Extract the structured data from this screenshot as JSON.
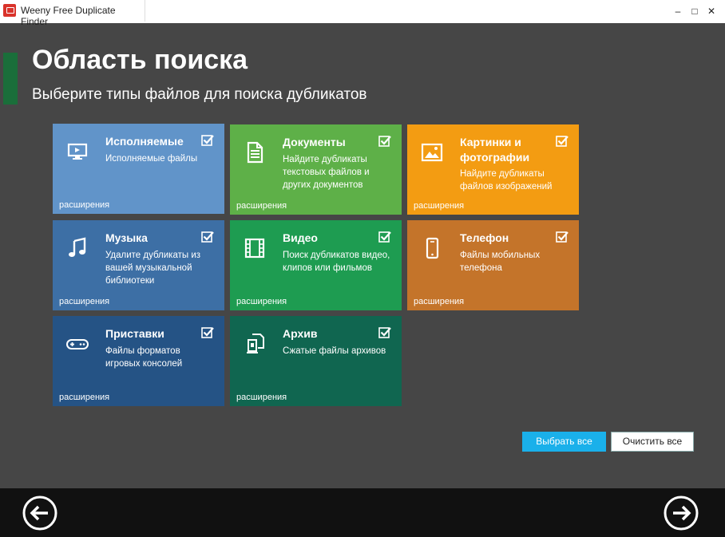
{
  "window": {
    "title": "Weeny Free Duplicate Finder",
    "controls": [
      "–",
      "□",
      "✕"
    ]
  },
  "header": {
    "title": "Область поиска",
    "subtitle": "Выберите типы файлов для поиска дубликатов"
  },
  "tiles": [
    {
      "title": "Исполняемые",
      "desc": "Исполняемые файлы",
      "ext": "расширения",
      "color": "#6194c9",
      "icon": "monitor-icon",
      "checked": true
    },
    {
      "title": "Документы",
      "desc": "Найдите дубликаты текстовых файлов и других документов",
      "ext": "расширения",
      "color": "#5eb048",
      "icon": "document-icon",
      "checked": true
    },
    {
      "title": "Картинки и фотографии",
      "desc": "Найдите дубликаты файлов изображений",
      "ext": "расширения",
      "color": "#f39c12",
      "icon": "image-icon",
      "checked": true
    },
    {
      "title": "Музыка",
      "desc": "Удалите дубликаты из вашей музыкальной библиотеки",
      "ext": "расширения",
      "color": "#3d6fa5",
      "icon": "music-icon",
      "checked": true
    },
    {
      "title": "Видео",
      "desc": "Поиск дубликатов видео, клипов или фильмов",
      "ext": "расширения",
      "color": "#1e9c51",
      "icon": "film-icon",
      "checked": true
    },
    {
      "title": "Телефон",
      "desc": "Файлы мобильных телефона",
      "ext": "расширения",
      "color": "#c4742a",
      "icon": "phone-icon",
      "checked": true
    },
    {
      "title": "Приставки",
      "desc": "Файлы форматов игровых консолей",
      "ext": "расширения",
      "color": "#255385",
      "icon": "gamepad-icon",
      "checked": true
    },
    {
      "title": "Архив",
      "desc": "Сжатые файлы архивов",
      "ext": "расширения",
      "color": "#106650",
      "icon": "archive-icon",
      "checked": true
    }
  ],
  "buttons": {
    "select_all": "Выбрать все",
    "clear_all": "Очистить все"
  },
  "footer": {
    "back_icon": "arrow-left-icon",
    "next_icon": "arrow-right-icon"
  }
}
